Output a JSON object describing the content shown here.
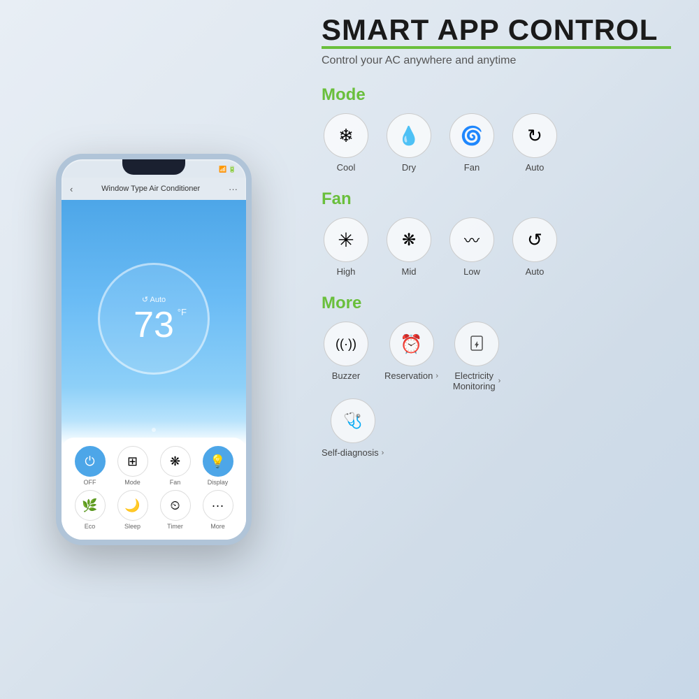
{
  "background": {
    "color": "#e8eef5"
  },
  "header": {
    "title_prefix": "SMART ",
    "title_bold": "APP CONTROL",
    "underline_color": "#6abf3c",
    "subtitle": "Control your AC anywhere and anytime"
  },
  "mode_section": {
    "label": "Mode",
    "items": [
      {
        "icon": "❄",
        "label": "Cool"
      },
      {
        "icon": "💧",
        "label": "Dry"
      },
      {
        "icon": "🌀",
        "label": "Fan"
      },
      {
        "icon": "↻",
        "label": "Auto"
      }
    ]
  },
  "fan_section": {
    "label": "Fan",
    "items": [
      {
        "icon": "✳",
        "label": "High"
      },
      {
        "icon": "❋",
        "label": "Mid"
      },
      {
        "icon": "〰",
        "label": "Low"
      },
      {
        "icon": "↺",
        "label": "Auto"
      }
    ]
  },
  "more_section": {
    "label": "More",
    "row1": [
      {
        "icon": "((·))",
        "label": "Buzzer",
        "has_arrow": false
      },
      {
        "icon": "⏰",
        "label": "Reservation",
        "has_arrow": true
      },
      {
        "icon": "⚡",
        "label": "Electricity\nMonitoring",
        "has_arrow": true
      }
    ],
    "row2": [
      {
        "icon": "🩺",
        "label": "Self-diagnosis",
        "has_arrow": true
      }
    ]
  },
  "phone": {
    "title": "Window Type Air Conditioner",
    "temp": "73",
    "unit": "°F",
    "mode": "Auto",
    "controls_row1": [
      {
        "label": "OFF",
        "active": true,
        "icon": "⏻"
      },
      {
        "label": "Mode",
        "active": false,
        "icon": "⊞"
      },
      {
        "label": "Fan",
        "active": false,
        "icon": "❋"
      },
      {
        "label": "Display",
        "active": true,
        "icon": "💡"
      }
    ],
    "controls_row2": [
      {
        "label": "Eco",
        "active": false,
        "icon": "🌿"
      },
      {
        "label": "Sleep",
        "active": false,
        "icon": "🌙"
      },
      {
        "label": "Timer",
        "active": false,
        "icon": "⏲"
      },
      {
        "label": "More",
        "active": false,
        "icon": "···"
      }
    ]
  }
}
